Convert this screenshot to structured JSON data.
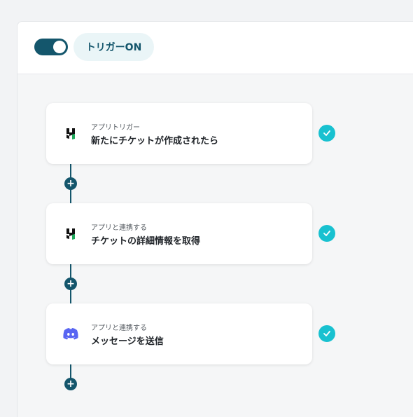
{
  "header": {
    "toggle_state": "on",
    "trigger_label": "トリガーON"
  },
  "flow": {
    "steps": [
      {
        "subtitle": "アプリトリガー",
        "title": "新たにチケットが作成されたら",
        "app_icon": "ticket-app-icon",
        "status": "completed"
      },
      {
        "subtitle": "アプリと連携する",
        "title": "チケットの詳細情報を取得",
        "app_icon": "ticket-app-icon",
        "status": "completed"
      },
      {
        "subtitle": "アプリと連携する",
        "title": "メッセージを送信",
        "app_icon": "discord-icon",
        "status": "completed"
      }
    ],
    "add_button_icon": "plus-icon",
    "status_icon": "check-icon"
  },
  "colors": {
    "accent": "#14566c",
    "check": "#18c1d0",
    "discord": "#5865f2",
    "ticket_green": "#1fa85b"
  }
}
